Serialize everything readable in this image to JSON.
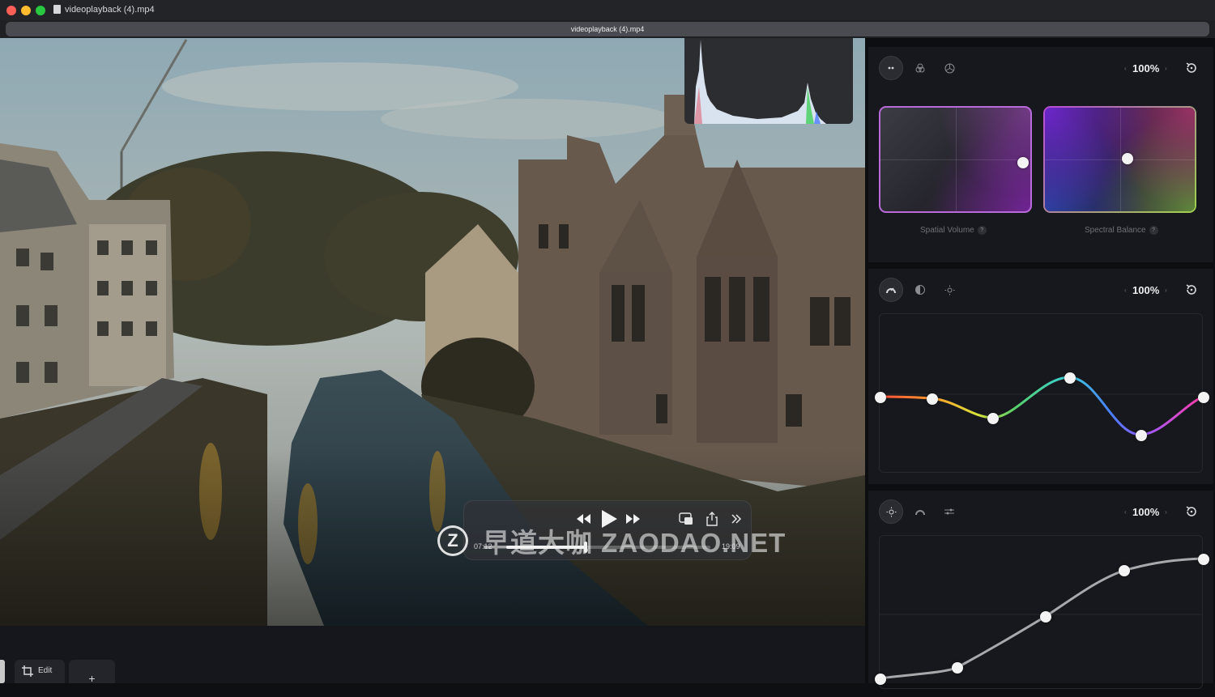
{
  "window": {
    "filename": "videoplayback (4).mp4",
    "tab_title": "videoplayback (4).mp4"
  },
  "player": {
    "current_time": "07:12",
    "total_time": "19:09",
    "progress": 0.39,
    "icons": [
      "rewind-icon",
      "play-icon",
      "fast-forward-icon",
      "picture-in-picture-icon",
      "share-icon",
      "more-icon"
    ]
  },
  "watermark": {
    "logo_letter": "Z",
    "text": "早道大咖  ZAODAO.NET"
  },
  "bottom_bar": {
    "edit_label": "Edit",
    "add_label": "+"
  },
  "panel": {
    "color_section": {
      "modes": [
        "dots-icon",
        "color-circles-icon",
        "aperture-icon"
      ],
      "percent": "100%",
      "pads": [
        {
          "label": "Spatial Volume",
          "help": "?",
          "point": [
            0.95,
            0.53
          ]
        },
        {
          "label": "Spectral Balance",
          "help": "?",
          "point": [
            0.55,
            0.49
          ]
        }
      ]
    },
    "hue_section": {
      "modes": [
        "hue-gauge-icon",
        "half-moon-icon",
        "sun-icon"
      ],
      "percent": "100%"
    },
    "tone_section": {
      "modes": [
        "sun-icon",
        "tone-gauge-icon",
        "sliders-icon"
      ],
      "percent": "100%"
    }
  },
  "colors": {
    "accent_pink": "#c04fd0",
    "accent_green": "#9fd34a",
    "panel_bg": "#17181d"
  }
}
